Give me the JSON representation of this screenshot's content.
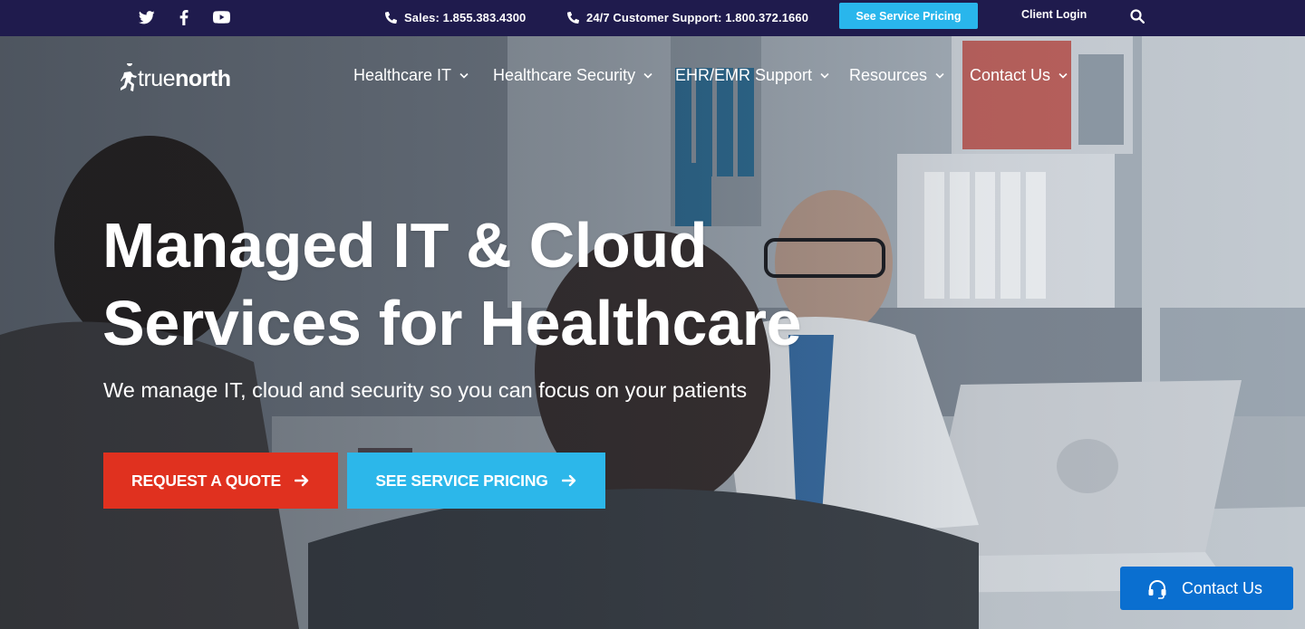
{
  "topbar": {
    "social": [
      "twitter-icon",
      "facebook-icon",
      "youtube-icon"
    ],
    "sales": "Sales: 1.855.383.4300",
    "support": "24/7 Customer Support: 1.800.372.1660",
    "pricing_button": "See Service Pricing",
    "client_login": "Client Login"
  },
  "brand": {
    "logo_true": "true",
    "logo_north": "north"
  },
  "nav": {
    "items": [
      {
        "label": "Healthcare IT"
      },
      {
        "label": "Healthcare Security"
      },
      {
        "label": "EHR/EMR Support"
      },
      {
        "label": "Resources"
      },
      {
        "label": "Contact Us"
      }
    ]
  },
  "hero": {
    "headline_line1": "Managed IT & Cloud",
    "headline_line2": "Services for Healthcare",
    "subheadline": "We manage IT, cloud and security so you can focus on your patients",
    "cta_quote": "REQUEST A QUOTE",
    "cta_pricing": "SEE SERVICE PRICING"
  },
  "contact_widget": {
    "label": "Contact Us"
  },
  "colors": {
    "topbar": "#1f1b4d",
    "accent_blue": "#29b6ec",
    "accent_red": "#e0311f",
    "contact_blue": "#0a6fd0"
  }
}
